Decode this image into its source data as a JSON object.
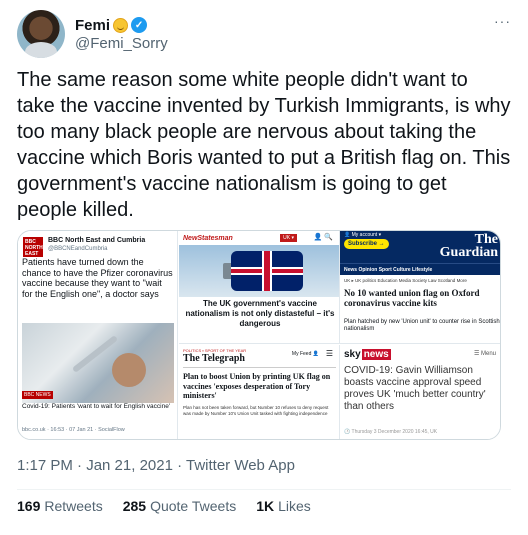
{
  "user": {
    "name": "Femi",
    "handle": "@Femi_Sorry",
    "verified_mark": "✓"
  },
  "more_icon": "···",
  "tweet_text": "The same reason some white people didn't want to take the vaccine invented by Turkish Immigrants, is why too many black people are nervous about taking the vaccine which Boris wanted to put a British flag on. This government's vaccine nationalism is going to get people killed.",
  "media": {
    "bbc": {
      "logo": "BBC NORTH EAST & CUMBRIA",
      "name": "BBC North East and Cumbria",
      "handle": "@BBCNEandCumbria",
      "text": "Patients have turned down the chance to have the Pfizer coronavirus vaccine because they want to \"wait for the English one\", a doctor says",
      "badge": "BBC NEWS",
      "caption": "Covid-19: Patients 'want to wait for English vaccine'",
      "source": "bbc.co.uk · 16:53 · 07 Jan 21 · SocialFlow"
    },
    "newstatesman": {
      "logo": "NewStatesman",
      "tag": "UK ▾",
      "icons": "👤 🔍",
      "headline": "The UK government's vaccine nationalism is not only distasteful – it's dangerous"
    },
    "guardian": {
      "account": "👤 My account ▾",
      "subscribe": "Subscribe →",
      "logo_line1": "The",
      "logo_line2": "Guardian",
      "nav": "News  Opinion  Sport  Culture  Lifestyle",
      "subnav": "UK ▸ UK politics  Education  Media  Society  Law  Scotland  More",
      "headline": "No 10 wanted union flag on Oxford coronavirus vaccine kits",
      "standfirst": "Plan hatched by new 'Union unit' to counter rise in Scottish nationalism"
    },
    "telegraph": {
      "tag": "POLITICS ▪ SPORT OF THE YEAR",
      "logo": "The Telegraph",
      "feed": "My Feed 👤",
      "menu": "☰",
      "headline": "Plan to boost Union by printing UK flag on vaccines 'exposes desperation of Tory ministers'",
      "standfirst": "Plan has not been taken forward, but Number 10 refuses to deny request was made by Number 10's Union Unit tasked with fighting independence"
    },
    "sky": {
      "logo": "sky",
      "logo_news": "news",
      "menu": "☰ Menu",
      "headline": "COVID-19: Gavin Williamson boasts vaccine approval speed proves UK 'much better country' than others",
      "date": "🕐 Thursday 3 December 2020 16:45, UK"
    }
  },
  "meta": "1:17 PM · Jan 21, 2021 · Twitter Web App",
  "stats": {
    "retweets_count": "169",
    "retweets_label": "Retweets",
    "quotes_count": "285",
    "quotes_label": "Quote Tweets",
    "likes_count": "1K",
    "likes_label": "Likes"
  }
}
